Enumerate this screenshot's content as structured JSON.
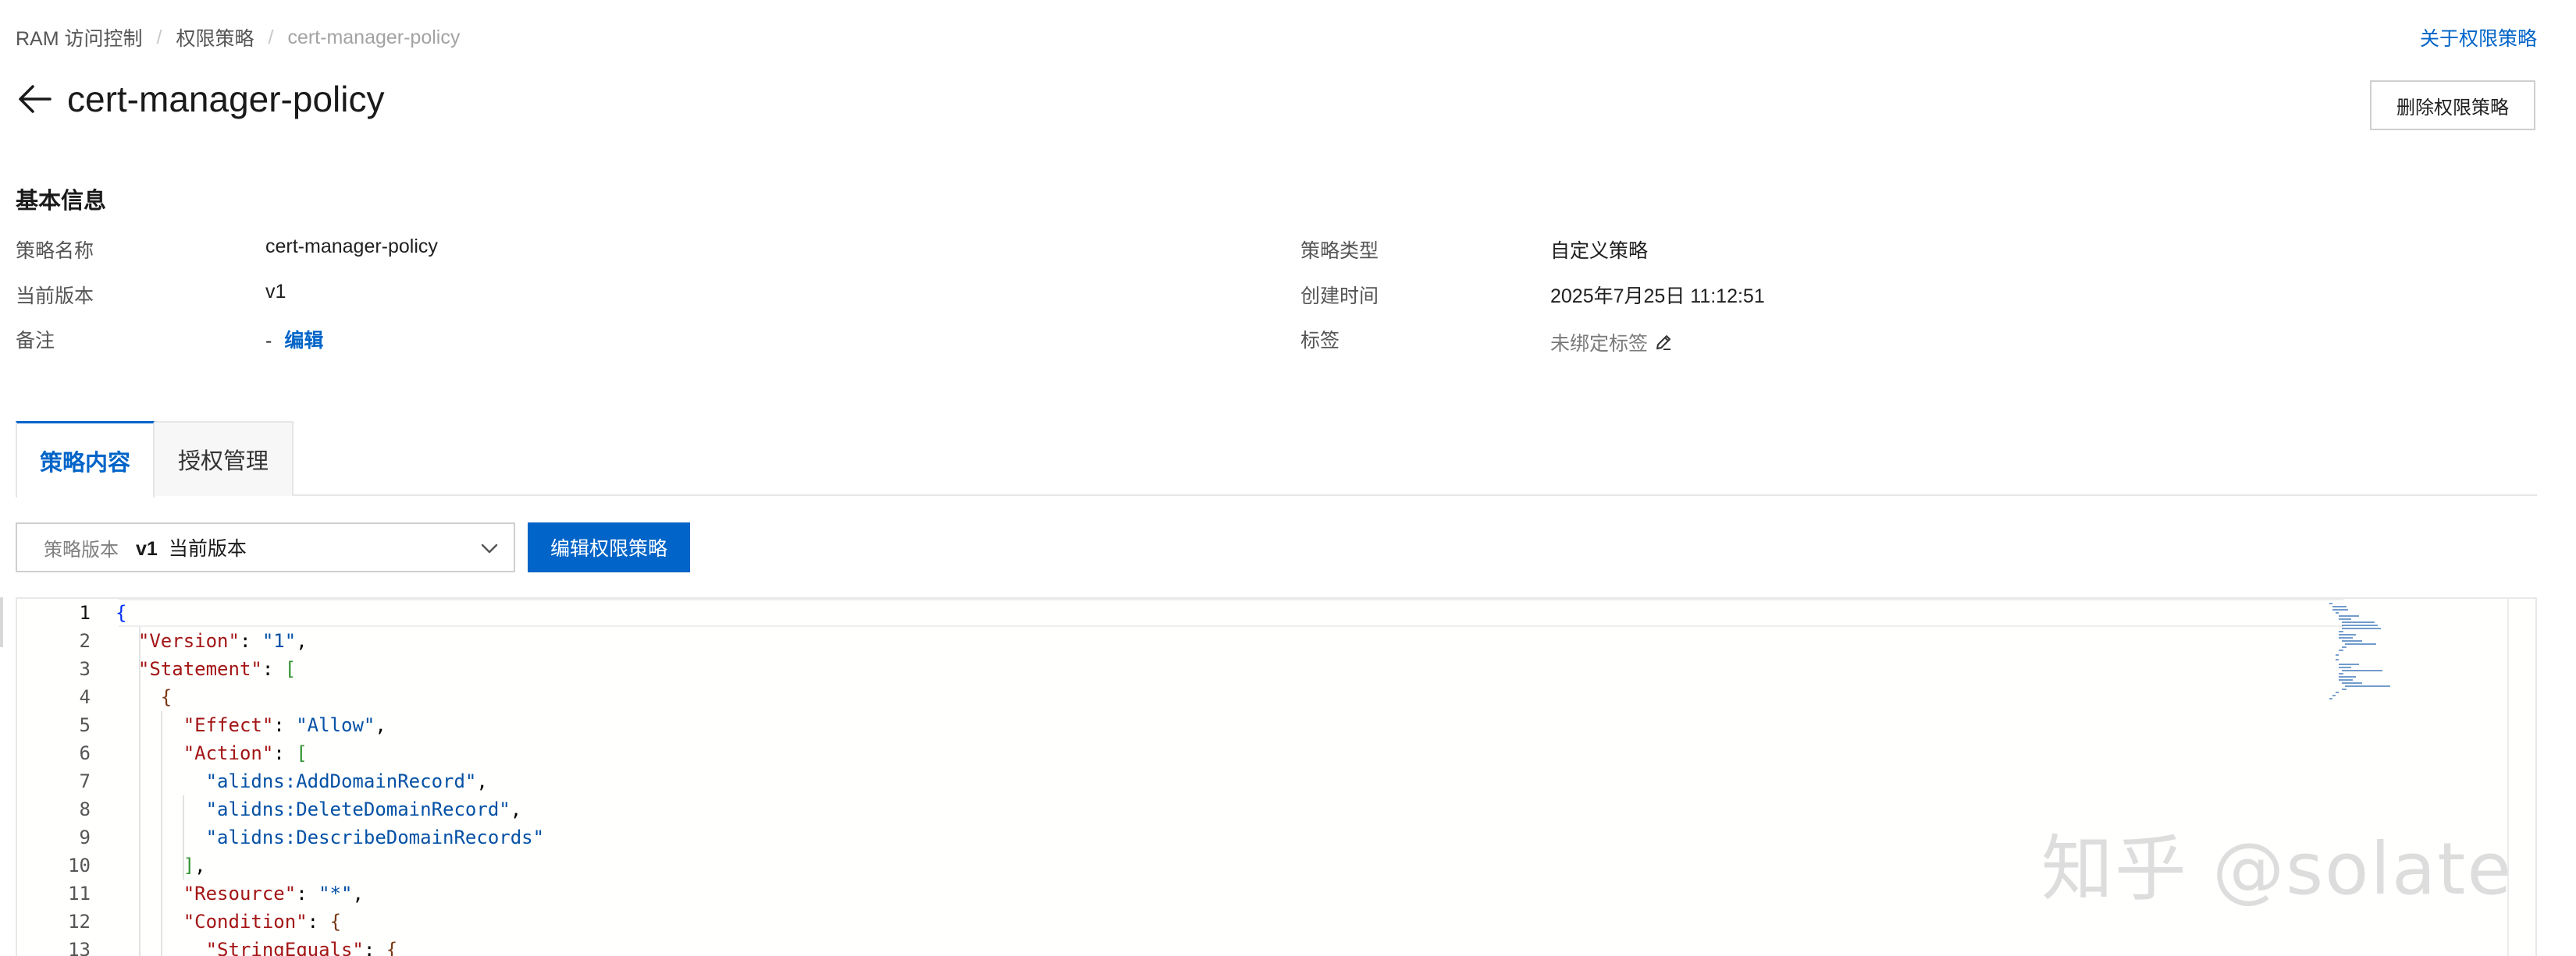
{
  "breadcrumb": [
    "RAM 访问控制",
    "权限策略",
    "cert-manager-policy"
  ],
  "top_link": "关于权限策略",
  "title": "cert-manager-policy",
  "delete_button": "删除权限策略",
  "basic_info": {
    "heading": "基本信息",
    "policy_name_label": "策略名称",
    "policy_name": "cert-manager-policy",
    "current_version_label": "当前版本",
    "current_version": "v1",
    "remark_label": "备注",
    "remark_value": "-",
    "remark_edit": "编辑",
    "policy_type_label": "策略类型",
    "policy_type": "自定义策略",
    "created_label": "创建时间",
    "created": "2025年7月25日 11:12:51",
    "tags_label": "标签",
    "tags_value": "未绑定标签"
  },
  "tabs": [
    "策略内容",
    "授权管理"
  ],
  "version_select": {
    "label": "策略版本",
    "version": "v1",
    "suffix": "当前版本"
  },
  "edit_policy_button": "编辑权限策略",
  "code_lines": [
    {
      "no": "1",
      "text": "{"
    },
    {
      "no": "2",
      "text": "  \"Version\": \"1\","
    },
    {
      "no": "3",
      "text": "  \"Statement\": ["
    },
    {
      "no": "4",
      "text": "    {"
    },
    {
      "no": "5",
      "text": "      \"Effect\": \"Allow\","
    },
    {
      "no": "6",
      "text": "      \"Action\": ["
    },
    {
      "no": "7",
      "text": "        \"alidns:AddDomainRecord\","
    },
    {
      "no": "8",
      "text": "        \"alidns:DeleteDomainRecord\","
    },
    {
      "no": "9",
      "text": "        \"alidns:DescribeDomainRecords\""
    },
    {
      "no": "10",
      "text": "      ],"
    },
    {
      "no": "11",
      "text": "      \"Resource\": \"*\","
    },
    {
      "no": "12",
      "text": "      \"Condition\": {"
    },
    {
      "no": "13",
      "text": "        \"StringEquals\": {"
    }
  ],
  "watermark": "知乎 @solate",
  "colors": {
    "accent": "#0064c8",
    "json_key": "#a31515",
    "json_string": "#0451a5"
  }
}
